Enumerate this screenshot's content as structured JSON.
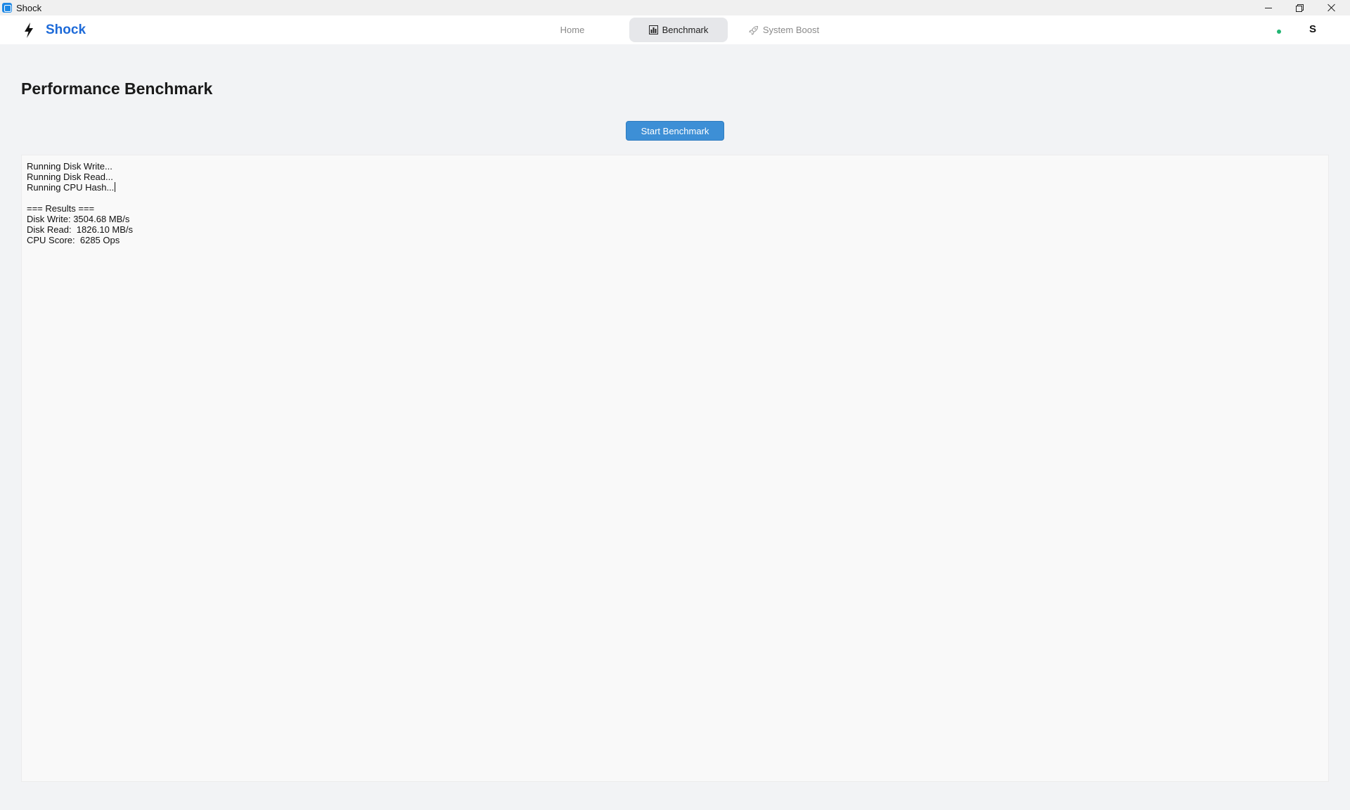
{
  "window": {
    "title": "Shock"
  },
  "header": {
    "brand": "Shock",
    "tabs": [
      {
        "label": "Home",
        "active": false
      },
      {
        "label": "Benchmark",
        "active": true,
        "icon": "bar-chart-icon"
      },
      {
        "label": "System Boost",
        "active": false,
        "icon": "rocket-icon"
      }
    ],
    "user_initial": "S",
    "status_color": "#22b573"
  },
  "main": {
    "title": "Performance Benchmark",
    "start_label": "Start Benchmark",
    "output_lines": [
      "Running Disk Write...",
      "Running Disk Read...",
      "Running CPU Hash...",
      "",
      "=== Results ===",
      "Disk Write: 3504.68 MB/s",
      "Disk Read:  1826.10 MB/s",
      "CPU Score:  6285 Ops"
    ]
  },
  "colors": {
    "accent": "#1d6ad8",
    "button": "#3d8fd6"
  }
}
